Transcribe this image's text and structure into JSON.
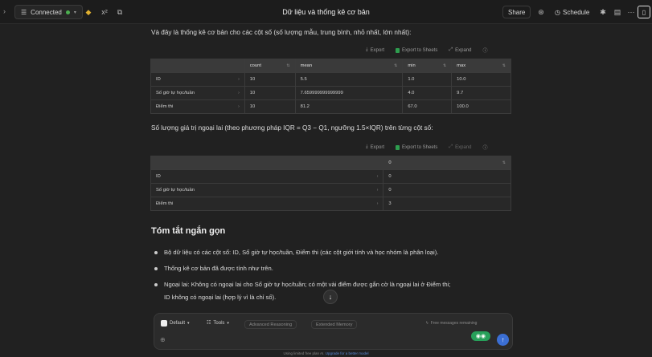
{
  "topbar": {
    "connection": "Connected",
    "title": "Dữ liệu và thống kê cơ bản",
    "share": "Share",
    "schedule": "Schedule"
  },
  "section1": {
    "intro": "Và đây là thống kê cơ bản cho các cột số (số lượng mẫu, trung bình, nhỏ nhất, lớn nhất):",
    "export": "Export",
    "export_sheets": "Export to Sheets",
    "expand": "Expand",
    "columns": [
      "",
      "count",
      "mean",
      "min",
      "max"
    ],
    "rows": [
      [
        "ID",
        "10",
        "5.5",
        "1.0",
        "10.0"
      ],
      [
        "Số giờ tự học/tuần",
        "10",
        "7.659999999999999",
        "4.0",
        "9.7"
      ],
      [
        "Điểm thi",
        "10",
        "81.2",
        "67.0",
        "100.0"
      ]
    ]
  },
  "section2": {
    "intro": "Số lượng giá trị ngoại lai (theo phương pháp IQR = Q3 − Q1, ngưỡng 1.5×IQR) trên từng cột số:",
    "export": "Export",
    "export_sheets": "Export to Sheets",
    "expand": "Expand",
    "columns": [
      "",
      "0"
    ],
    "rows": [
      [
        "ID",
        "0"
      ],
      [
        "Số giờ tự học/tuần",
        "0"
      ],
      [
        "Điểm thi",
        "3"
      ]
    ]
  },
  "summary": {
    "heading": "Tóm tắt ngắn gọn",
    "bullets": [
      "Bộ dữ liệu có các cột số: ID, Số giờ tự học/tuần, Điểm thi (các cột giới tính và học nhóm là phân loại).",
      "Thống kê cơ bản đã được tính như trên.",
      "Ngoại lai: Không có ngoại lai cho Số giờ tự học/tuần; có một vài điểm được gắn cờ là ngoại lai ở Điểm thi;",
      "ID không có ngoại lai (hợp lý vì là chỉ số)."
    ]
  },
  "composer": {
    "model": "Default",
    "tools": "Tools",
    "reasoning": "Advanced Reasoning",
    "memory": "Extended Memory",
    "remaining": "Free messages remaining"
  },
  "footer": {
    "text": "Using limited free plan AI.",
    "link": "Upgrade for a better model"
  },
  "colors": {
    "accent": "#3b6fd4",
    "connected": "#4caf50",
    "sheets": "#2e9e4f"
  }
}
